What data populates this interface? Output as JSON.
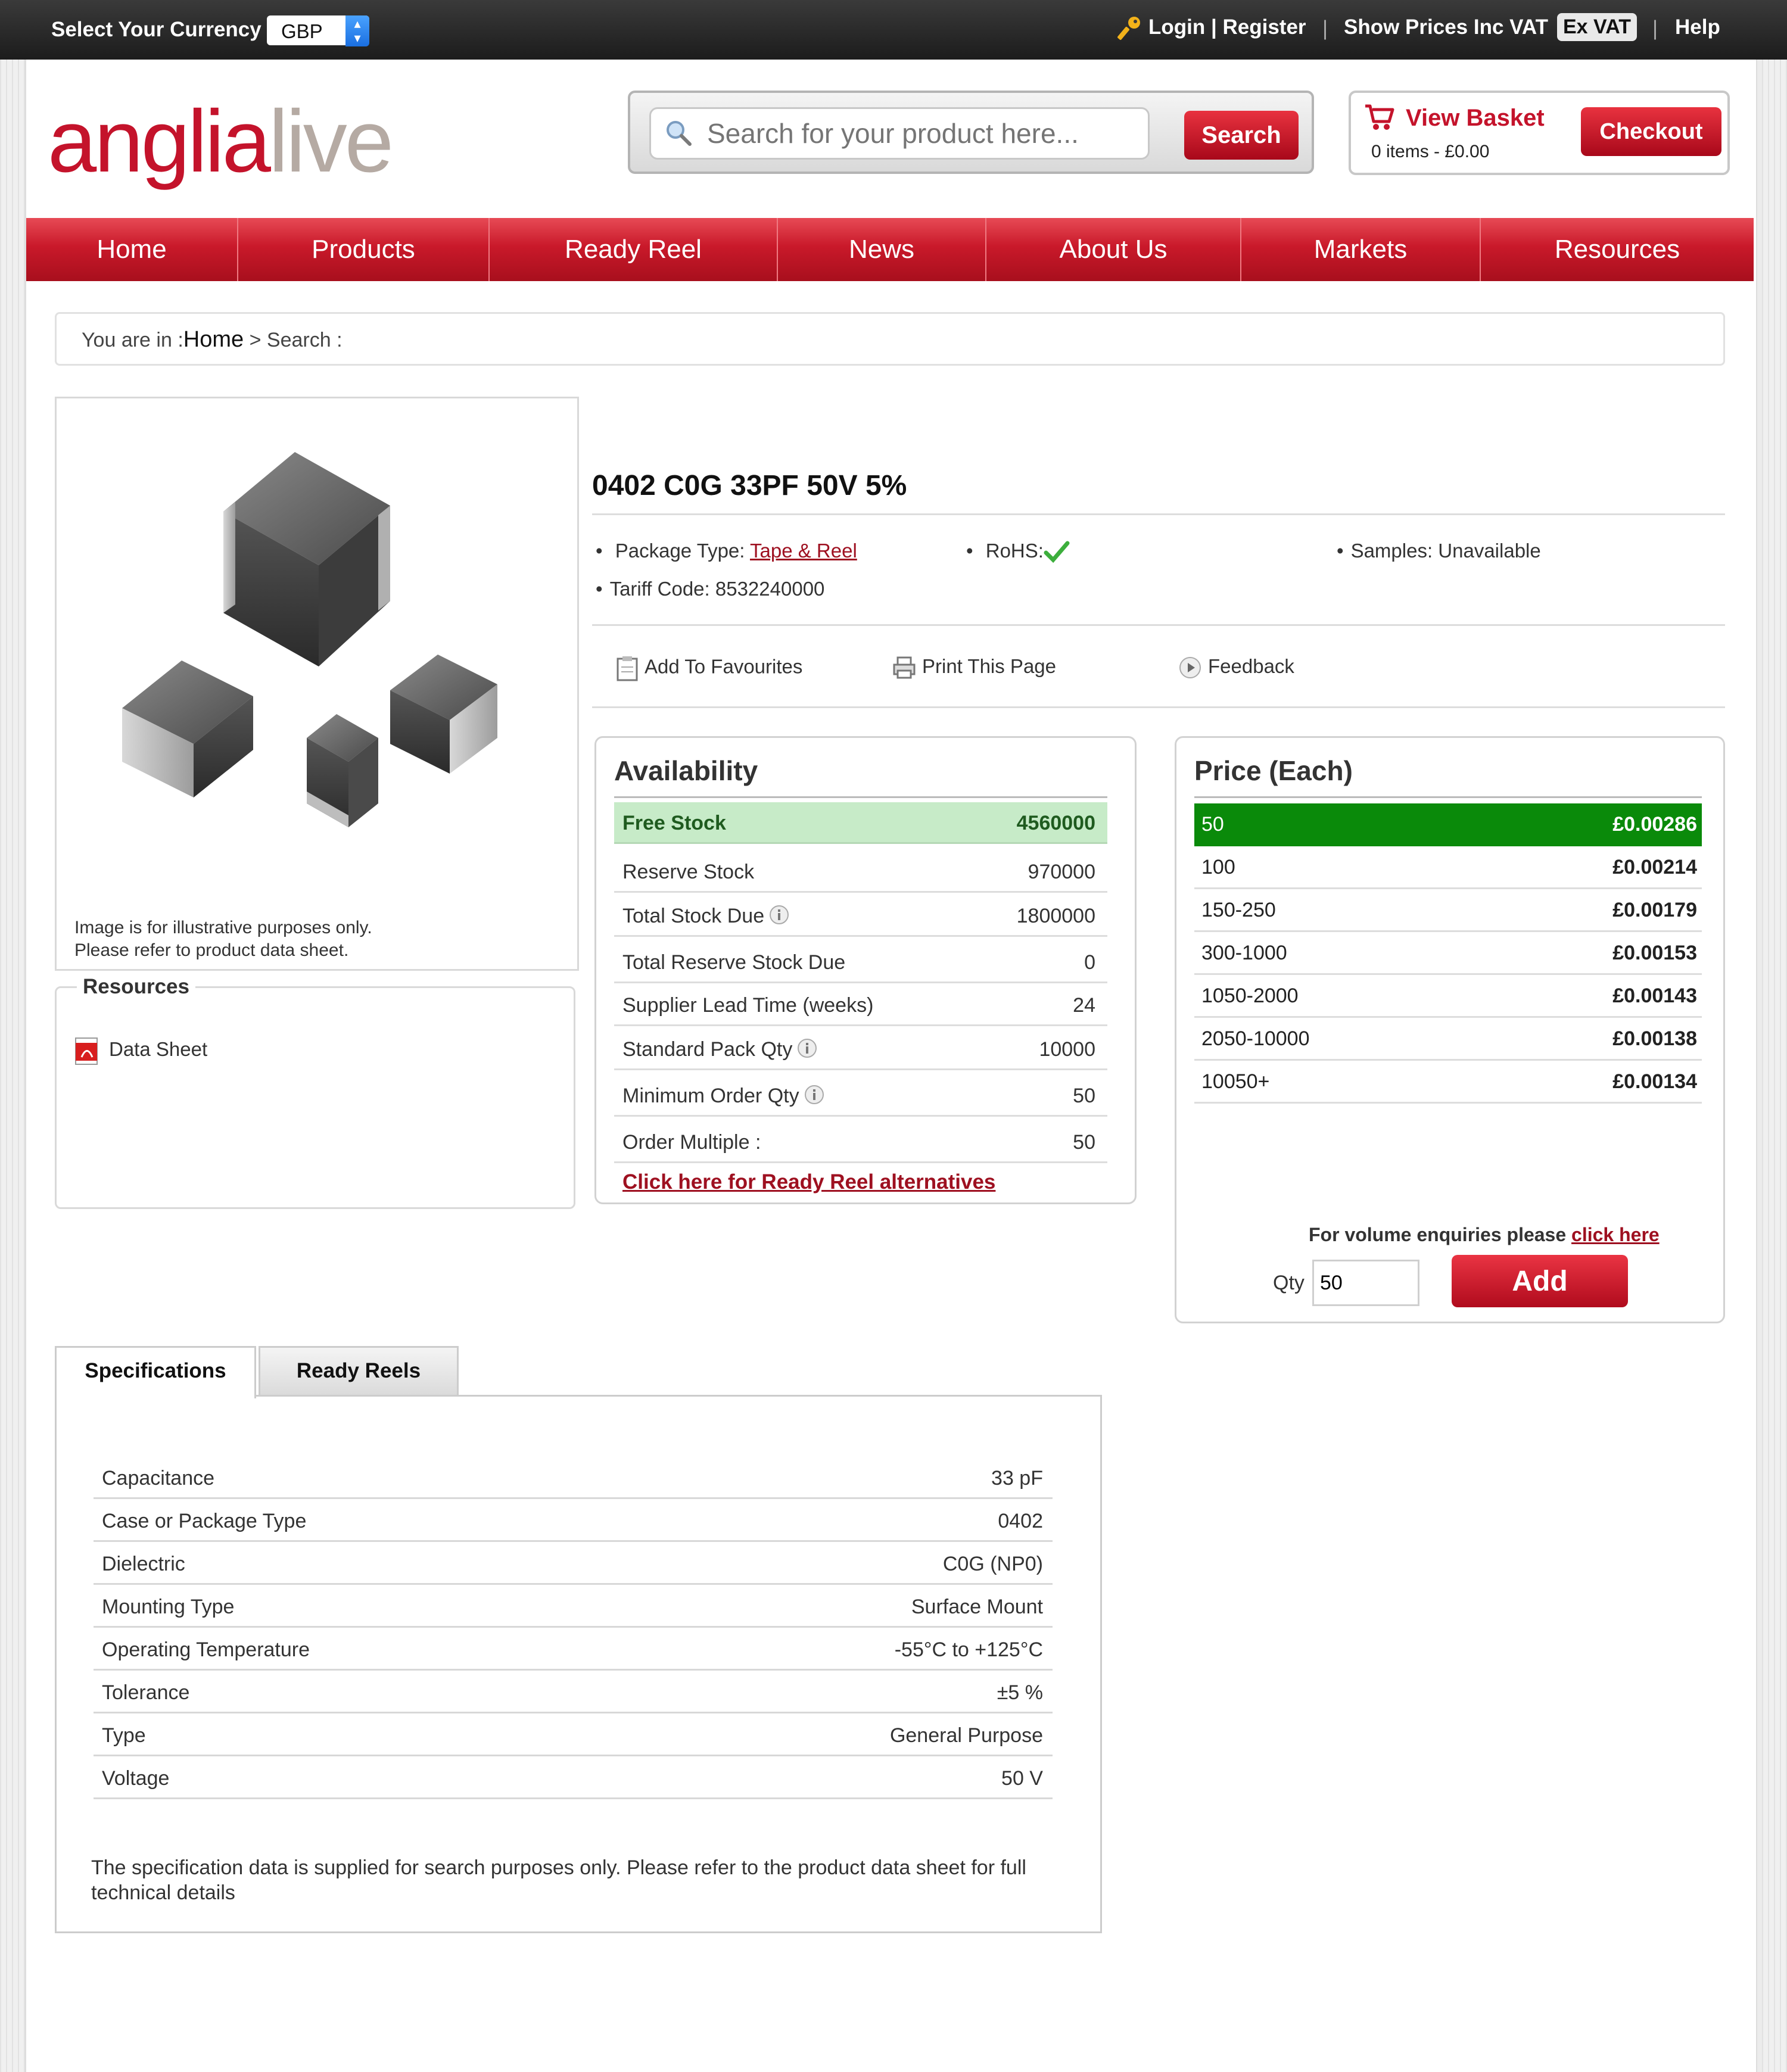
{
  "topbar": {
    "currency_label": "Select Your Currency",
    "currency_value": "GBP",
    "login_register": "Login | Register",
    "show_prices": "Show Prices Inc VAT",
    "ex_vat": "Ex VAT",
    "help": "Help",
    "separator": "|"
  },
  "logo": {
    "part1": "anglia",
    "part2": "live"
  },
  "search": {
    "placeholder": "Search for your product here...",
    "button": "Search"
  },
  "basket": {
    "label": "View Basket",
    "summary": "0 items - £0.00",
    "checkout": "Checkout"
  },
  "nav": [
    "Home",
    "Products",
    "Ready Reel",
    "News",
    "About Us",
    "Markets",
    "Resources"
  ],
  "breadcrumb": {
    "prefix": "You are in :",
    "home": "Home",
    "rest": " > Search :"
  },
  "image_note": {
    "line1": "Image is for illustrative purposes only.",
    "line2": "Please refer to product data sheet."
  },
  "resources": {
    "title": "Resources",
    "datasheet": "Data Sheet"
  },
  "product": {
    "title": "0402 C0G 33PF 50V 5%",
    "package_label": "Package Type: ",
    "package_value": "Tape & Reel",
    "rohs": "RoHS:",
    "samples": "Samples: Unavailable",
    "tariff": "Tariff Code: 8532240000"
  },
  "actions": {
    "favourites": "Add To Favourites",
    "print": "Print This Page",
    "feedback": "Feedback"
  },
  "availability": {
    "title": "Availability",
    "rows": [
      {
        "label": "Free Stock",
        "value": "4560000"
      },
      {
        "label": "Reserve Stock",
        "value": "970000"
      },
      {
        "label": "Total Stock Due",
        "value": "1800000"
      },
      {
        "label": "Total Reserve Stock Due",
        "value": "0"
      },
      {
        "label": "Supplier Lead Time (weeks)",
        "value": "24"
      },
      {
        "label": "Standard Pack Qty",
        "value": "10000"
      },
      {
        "label": "Minimum Order Qty",
        "value": "50"
      },
      {
        "label": "Order Multiple :",
        "value": "50"
      }
    ],
    "ready_reel_link": "Click here for Ready Reel alternatives"
  },
  "price": {
    "title": "Price (Each)",
    "rows": [
      {
        "qty": "50",
        "price": "£0.00286"
      },
      {
        "qty": "100",
        "price": "£0.00214"
      },
      {
        "qty": "150-250",
        "price": "£0.00179"
      },
      {
        "qty": "300-1000",
        "price": "£0.00153"
      },
      {
        "qty": "1050-2000",
        "price": "£0.00143"
      },
      {
        "qty": "2050-10000",
        "price": "£0.00138"
      },
      {
        "qty": "10050+",
        "price": "£0.00134"
      }
    ],
    "volume_text": "For volume enquiries please ",
    "volume_link": "click here",
    "qty_label": "Qty",
    "qty_value": "50",
    "add": "Add"
  },
  "tabs": {
    "specifications": "Specifications",
    "ready_reels": "Ready Reels"
  },
  "specs": {
    "rows": [
      {
        "key": "Capacitance",
        "value": "33 pF"
      },
      {
        "key": "Case or Package Type",
        "value": "0402"
      },
      {
        "key": "Dielectric",
        "value": "C0G (NP0)"
      },
      {
        "key": "Mounting Type",
        "value": "Surface Mount"
      },
      {
        "key": "Operating Temperature",
        "value": "-55°C to +125°C"
      },
      {
        "key": "Tolerance",
        "value": "±5 %"
      },
      {
        "key": "Type",
        "value": "General Purpose"
      },
      {
        "key": "Voltage",
        "value": "50 V"
      }
    ],
    "note": "The specification data is supplied for search purposes only. Please refer to the product data sheet for full technical details"
  },
  "colors": {
    "brand_red": "#c4132b",
    "stock_green": "#c7ebc8",
    "price_selected": "#0a8a0a"
  }
}
